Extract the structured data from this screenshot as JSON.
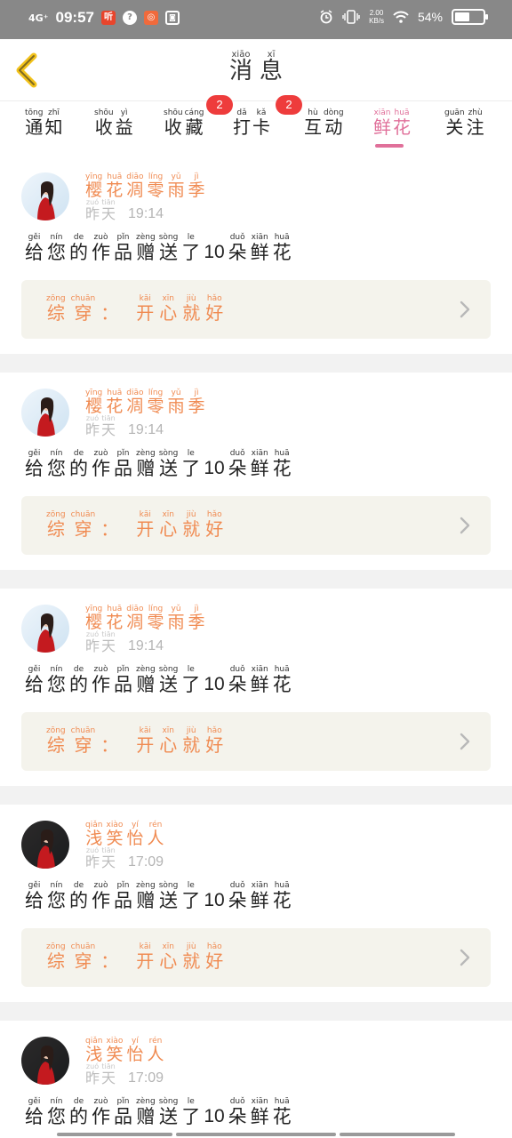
{
  "status_bar": {
    "network": "4G⁺",
    "time": "09:57",
    "speed_value": "2.00",
    "speed_unit": "KB/s",
    "battery": "54%",
    "battery_level": 0.54,
    "app_icons": [
      "ting-app-icon",
      "help-app-icon",
      "camera-app-icon",
      "robot-app-icon"
    ],
    "status_icons": [
      "alarm-icon",
      "vibrate-icon",
      "wifi-icon"
    ]
  },
  "header": {
    "title": [
      {
        "char": "消",
        "py": "xiāo"
      },
      {
        "char": "息",
        "py": "xī"
      }
    ],
    "back_icon": "chevron-left-icon",
    "back_color": "#f2c21b"
  },
  "tabs": [
    {
      "id": "notice",
      "chars": [
        {
          "char": "通",
          "py": "tōng"
        },
        {
          "char": "知",
          "py": "zhī"
        }
      ],
      "badge": ""
    },
    {
      "id": "income",
      "chars": [
        {
          "char": "收",
          "py": "shōu"
        },
        {
          "char": "益",
          "py": "yì"
        }
      ],
      "badge": ""
    },
    {
      "id": "collect",
      "chars": [
        {
          "char": "收",
          "py": "shōu"
        },
        {
          "char": "藏",
          "py": "cáng"
        }
      ],
      "badge": "2"
    },
    {
      "id": "checkin",
      "chars": [
        {
          "char": "打",
          "py": "dǎ"
        },
        {
          "char": "卡",
          "py": "kǎ"
        }
      ],
      "badge": "2"
    },
    {
      "id": "interact",
      "chars": [
        {
          "char": "互",
          "py": "hù"
        },
        {
          "char": "动",
          "py": "dòng"
        }
      ],
      "badge": ""
    },
    {
      "id": "flowers",
      "chars": [
        {
          "char": "鲜",
          "py": "xiān"
        },
        {
          "char": "花",
          "py": "huā"
        }
      ],
      "badge": "",
      "active": true
    },
    {
      "id": "follow",
      "chars": [
        {
          "char": "关",
          "py": "guān"
        },
        {
          "char": "注",
          "py": "zhù"
        }
      ],
      "badge": ""
    }
  ],
  "colors": {
    "accent": "#e0709a",
    "name": "#f08b52",
    "badge": "#ee3c3c",
    "work_box": "#f4f3ec"
  },
  "notifications": [
    {
      "user": [
        {
          "char": "樱",
          "py": "yīng"
        },
        {
          "char": "花",
          "py": "huā"
        },
        {
          "char": "凋",
          "py": "diāo"
        },
        {
          "char": "零",
          "py": "líng"
        },
        {
          "char": "雨",
          "py": "yǔ"
        },
        {
          "char": "季",
          "py": "jì"
        }
      ],
      "day": [
        {
          "char": "昨",
          "py": "zuó"
        },
        {
          "char": "天",
          "py": "tiān"
        }
      ],
      "time": "19:14",
      "avatar": "light",
      "message": [
        {
          "char": "给",
          "py": "gěi"
        },
        {
          "char": "您",
          "py": "nín"
        },
        {
          "char": "的",
          "py": "de"
        },
        {
          "char": "作",
          "py": "zuò"
        },
        {
          "char": "品",
          "py": "pǐn"
        },
        {
          "char": "赠",
          "py": "zèng"
        },
        {
          "char": "送",
          "py": "sòng"
        },
        {
          "char": "了",
          "py": "le"
        },
        {
          "num": "10"
        },
        {
          "char": "朵",
          "py": "duǒ"
        },
        {
          "char": "鲜",
          "py": "xiān"
        },
        {
          "char": "花",
          "py": "huā"
        }
      ],
      "work": [
        {
          "char": "综",
          "py": "zōng"
        },
        {
          "char": "穿",
          "py": "chuān"
        },
        {
          "char": "：",
          "py": ""
        },
        {
          "char": "开",
          "py": "kāi"
        },
        {
          "char": "心",
          "py": "xīn"
        },
        {
          "char": "就",
          "py": "jiù"
        },
        {
          "char": "好",
          "py": "hǎo"
        }
      ]
    },
    {
      "user": [
        {
          "char": "樱",
          "py": "yīng"
        },
        {
          "char": "花",
          "py": "huā"
        },
        {
          "char": "凋",
          "py": "diāo"
        },
        {
          "char": "零",
          "py": "líng"
        },
        {
          "char": "雨",
          "py": "yǔ"
        },
        {
          "char": "季",
          "py": "jì"
        }
      ],
      "day": [
        {
          "char": "昨",
          "py": "zuó"
        },
        {
          "char": "天",
          "py": "tiān"
        }
      ],
      "time": "19:14",
      "avatar": "light",
      "message": [
        {
          "char": "给",
          "py": "gěi"
        },
        {
          "char": "您",
          "py": "nín"
        },
        {
          "char": "的",
          "py": "de"
        },
        {
          "char": "作",
          "py": "zuò"
        },
        {
          "char": "品",
          "py": "pǐn"
        },
        {
          "char": "赠",
          "py": "zèng"
        },
        {
          "char": "送",
          "py": "sòng"
        },
        {
          "char": "了",
          "py": "le"
        },
        {
          "num": "10"
        },
        {
          "char": "朵",
          "py": "duǒ"
        },
        {
          "char": "鲜",
          "py": "xiān"
        },
        {
          "char": "花",
          "py": "huā"
        }
      ],
      "work": [
        {
          "char": "综",
          "py": "zōng"
        },
        {
          "char": "穿",
          "py": "chuān"
        },
        {
          "char": "：",
          "py": ""
        },
        {
          "char": "开",
          "py": "kāi"
        },
        {
          "char": "心",
          "py": "xīn"
        },
        {
          "char": "就",
          "py": "jiù"
        },
        {
          "char": "好",
          "py": "hǎo"
        }
      ]
    },
    {
      "user": [
        {
          "char": "樱",
          "py": "yīng"
        },
        {
          "char": "花",
          "py": "huā"
        },
        {
          "char": "凋",
          "py": "diāo"
        },
        {
          "char": "零",
          "py": "líng"
        },
        {
          "char": "雨",
          "py": "yǔ"
        },
        {
          "char": "季",
          "py": "jì"
        }
      ],
      "day": [
        {
          "char": "昨",
          "py": "zuó"
        },
        {
          "char": "天",
          "py": "tiān"
        }
      ],
      "time": "19:14",
      "avatar": "light",
      "message": [
        {
          "char": "给",
          "py": "gěi"
        },
        {
          "char": "您",
          "py": "nín"
        },
        {
          "char": "的",
          "py": "de"
        },
        {
          "char": "作",
          "py": "zuò"
        },
        {
          "char": "品",
          "py": "pǐn"
        },
        {
          "char": "赠",
          "py": "zèng"
        },
        {
          "char": "送",
          "py": "sòng"
        },
        {
          "char": "了",
          "py": "le"
        },
        {
          "num": "10"
        },
        {
          "char": "朵",
          "py": "duǒ"
        },
        {
          "char": "鲜",
          "py": "xiān"
        },
        {
          "char": "花",
          "py": "huā"
        }
      ],
      "work": [
        {
          "char": "综",
          "py": "zōng"
        },
        {
          "char": "穿",
          "py": "chuān"
        },
        {
          "char": "：",
          "py": ""
        },
        {
          "char": "开",
          "py": "kāi"
        },
        {
          "char": "心",
          "py": "xīn"
        },
        {
          "char": "就",
          "py": "jiù"
        },
        {
          "char": "好",
          "py": "hǎo"
        }
      ]
    },
    {
      "user": [
        {
          "char": "浅",
          "py": "qiǎn"
        },
        {
          "char": "笑",
          "py": "xiào"
        },
        {
          "char": "怡",
          "py": "yí"
        },
        {
          "char": "人",
          "py": "rén"
        }
      ],
      "day": [
        {
          "char": "昨",
          "py": "zuó"
        },
        {
          "char": "天",
          "py": "tiān"
        }
      ],
      "time": "17:09",
      "avatar": "dark",
      "message": [
        {
          "char": "给",
          "py": "gěi"
        },
        {
          "char": "您",
          "py": "nín"
        },
        {
          "char": "的",
          "py": "de"
        },
        {
          "char": "作",
          "py": "zuò"
        },
        {
          "char": "品",
          "py": "pǐn"
        },
        {
          "char": "赠",
          "py": "zèng"
        },
        {
          "char": "送",
          "py": "sòng"
        },
        {
          "char": "了",
          "py": "le"
        },
        {
          "num": "10"
        },
        {
          "char": "朵",
          "py": "duǒ"
        },
        {
          "char": "鲜",
          "py": "xiān"
        },
        {
          "char": "花",
          "py": "huā"
        }
      ],
      "work": [
        {
          "char": "综",
          "py": "zōng"
        },
        {
          "char": "穿",
          "py": "chuān"
        },
        {
          "char": "：",
          "py": ""
        },
        {
          "char": "开",
          "py": "kāi"
        },
        {
          "char": "心",
          "py": "xīn"
        },
        {
          "char": "就",
          "py": "jiù"
        },
        {
          "char": "好",
          "py": "hǎo"
        }
      ]
    },
    {
      "user": [
        {
          "char": "浅",
          "py": "qiǎn"
        },
        {
          "char": "笑",
          "py": "xiào"
        },
        {
          "char": "怡",
          "py": "yí"
        },
        {
          "char": "人",
          "py": "rén"
        }
      ],
      "day": [
        {
          "char": "昨",
          "py": "zuó"
        },
        {
          "char": "天",
          "py": "tiān"
        }
      ],
      "time": "17:09",
      "avatar": "dark",
      "message": [
        {
          "char": "给",
          "py": "gěi"
        },
        {
          "char": "您",
          "py": "nín"
        },
        {
          "char": "的",
          "py": "de"
        },
        {
          "char": "作",
          "py": "zuò"
        },
        {
          "char": "品",
          "py": "pǐn"
        },
        {
          "char": "赠",
          "py": "zèng"
        },
        {
          "char": "送",
          "py": "sòng"
        },
        {
          "char": "了",
          "py": "le"
        },
        {
          "num": "10"
        },
        {
          "char": "朵",
          "py": "duǒ"
        },
        {
          "char": "鲜",
          "py": "xiān"
        },
        {
          "char": "花",
          "py": "huā"
        }
      ],
      "work": []
    }
  ]
}
